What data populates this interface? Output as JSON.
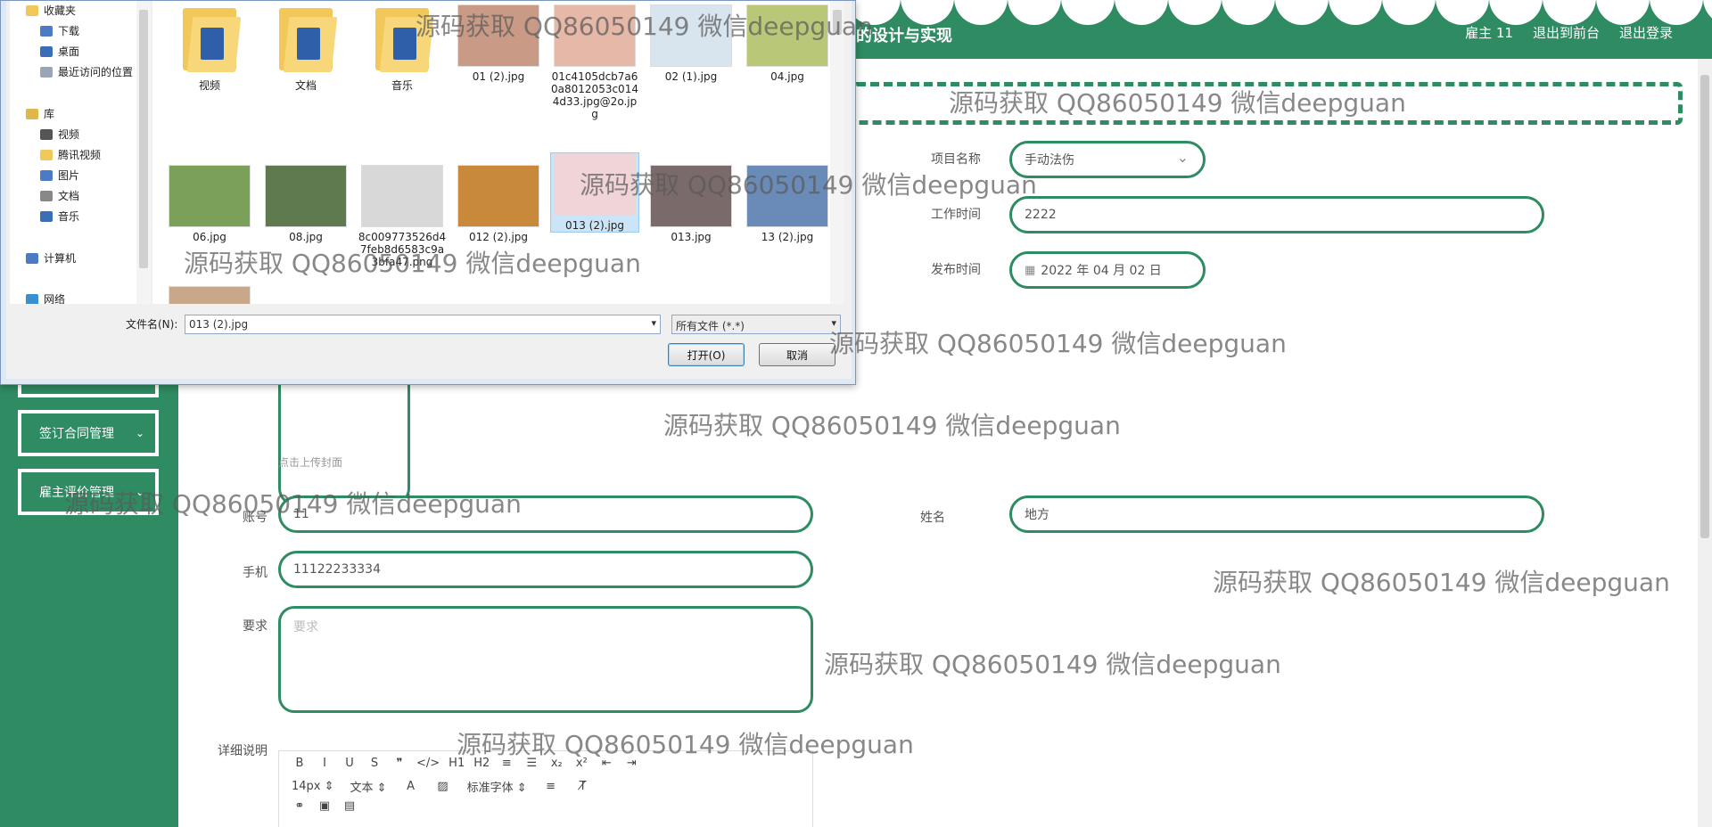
{
  "header": {
    "title": "的设计与实现",
    "links": [
      "雇主 11",
      "退出到前台",
      "退出登录"
    ]
  },
  "sidebar": {
    "items": [
      {
        "label": ""
      },
      {
        "label": "签订合同管理"
      },
      {
        "label": "雇主评价管理"
      }
    ]
  },
  "form": {
    "project_name_label": "项目名称",
    "project_name_value": "手动法伤",
    "work_time_label": "工作时间",
    "work_time_value": "2222",
    "publish_time_label": "发布时间",
    "publish_time_value": "2022 年 04 月 02 日",
    "upload_hint": "点击上传封面",
    "account_label": "账号",
    "account_value": "11",
    "name_label": "姓名",
    "name_value": "地方",
    "phone_label": "手机",
    "phone_value": "11122233334",
    "requirement_label": "要求",
    "requirement_placeholder": "要求",
    "detail_label": "详细说明"
  },
  "editor": {
    "row1": [
      "B",
      "I",
      "U",
      "S",
      "❞",
      "</>",
      "H1",
      "H2",
      "≡",
      "☰",
      "x₂",
      "x²",
      "⇤",
      "⇥"
    ],
    "font_size": "14px",
    "paragraph": "文本",
    "font_family": "标准字体"
  },
  "dialog": {
    "tree": [
      {
        "label": "收藏夹",
        "sub": false,
        "color": "#f2c85a"
      },
      {
        "label": "下载",
        "sub": true,
        "color": "#4a7bc4"
      },
      {
        "label": "桌面",
        "sub": true,
        "color": "#3a6fb8"
      },
      {
        "label": "最近访问的位置",
        "sub": true,
        "color": "#9aa6b8"
      },
      {
        "label": "库",
        "sub": false,
        "color": "#e0b84a"
      },
      {
        "label": "视频",
        "sub": true,
        "color": "#555"
      },
      {
        "label": "腾讯视频",
        "sub": true,
        "color": "#f2c85a"
      },
      {
        "label": "图片",
        "sub": true,
        "color": "#4a7bc4"
      },
      {
        "label": "文档",
        "sub": true,
        "color": "#888"
      },
      {
        "label": "音乐",
        "sub": true,
        "color": "#3a6fb8"
      },
      {
        "label": "计算机",
        "sub": false,
        "color": "#4a7bc4"
      },
      {
        "label": "网络",
        "sub": false,
        "color": "#3a8fcf"
      }
    ],
    "files": [
      {
        "name": "视频",
        "kind": "folder"
      },
      {
        "name": "文档",
        "kind": "folder"
      },
      {
        "name": "音乐",
        "kind": "folder"
      },
      {
        "name": "01 (2).jpg",
        "kind": "image",
        "color": "#c99a86"
      },
      {
        "name": "01c4105dcb7a60a8012053c0144d33.jpg@2o.jpg",
        "kind": "image",
        "color": "#e6b8a8"
      },
      {
        "name": "02 (1).jpg",
        "kind": "image",
        "color": "#d8e4ee"
      },
      {
        "name": "04.jpg",
        "kind": "image",
        "color": "#b8c878"
      },
      {
        "name": "06.jpg",
        "kind": "image",
        "color": "#7aa05a"
      },
      {
        "name": "08.jpg",
        "kind": "image",
        "color": "#5e7a4e"
      },
      {
        "name": "8c009773526d47feb8d6583c9a3bfa47.png",
        "kind": "image",
        "color": "#d8d8d8"
      },
      {
        "name": "012 (2).jpg",
        "kind": "image",
        "color": "#c88a3a"
      },
      {
        "name": "013 (2).jpg",
        "kind": "image",
        "color": "#f0d4d8",
        "selected": true
      },
      {
        "name": "013.jpg",
        "kind": "image",
        "color": "#7a6a6a"
      },
      {
        "name": "13 (2).jpg",
        "kind": "image",
        "color": "#6a8ab8"
      },
      {
        "name": "",
        "kind": "image",
        "color": "#c8a888"
      }
    ],
    "filename_label": "文件名(N):",
    "filename_value": "013 (2).jpg",
    "filetype_value": "所有文件 (*.*)",
    "open_label": "打开(O)",
    "cancel_label": "取消"
  },
  "watermark": "源码获取 QQ86050149 微信deepguan",
  "colors": {
    "accent": "#2e8b62"
  }
}
